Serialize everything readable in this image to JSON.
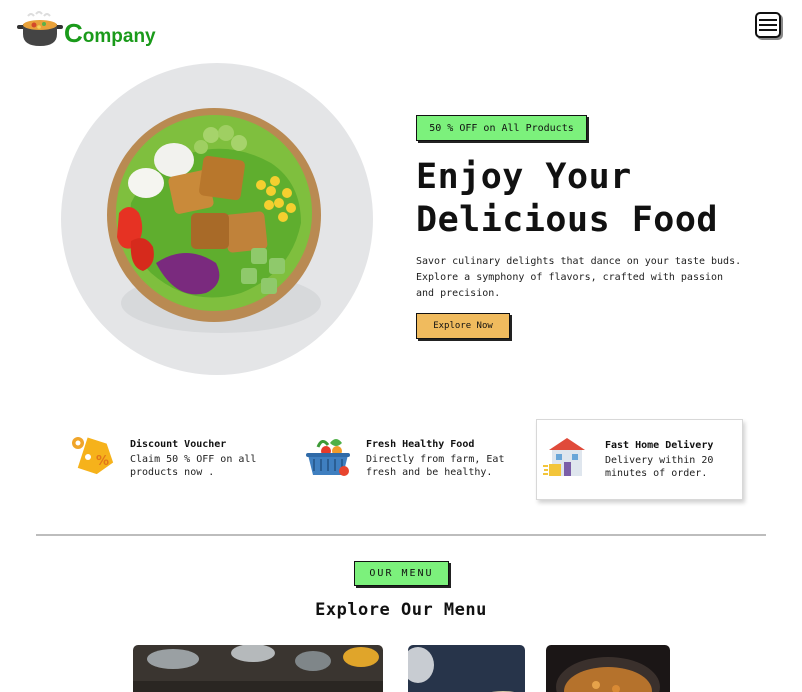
{
  "brand": {
    "logo_initial": "C",
    "logo_rest": "ompany"
  },
  "hero": {
    "offer_badge": "50 % OFF on All Products",
    "title_line1": "Enjoy Your",
    "title_line2": "Delicious Food",
    "description": "Savor culinary delights that dance on your taste buds. Explore a symphony of flavors, crafted with passion and precision.",
    "cta_label": "Explore Now"
  },
  "features": [
    {
      "title": "Discount Voucher",
      "desc_line1": "Claim 50 % OFF on all",
      "desc_line2": "products now .",
      "icon": "discount-tag-icon"
    },
    {
      "title": "Fresh Healthy Food",
      "desc_line1": "Directly from farm, Eat",
      "desc_line2": "fresh and be healthy.",
      "icon": "vegetable-basket-icon"
    },
    {
      "title": "Fast Home Delivery",
      "desc_line1": "Delivery within 20",
      "desc_line2": "minutes of order.",
      "icon": "home-delivery-icon"
    }
  ],
  "menu_section": {
    "badge": "OUR MENU",
    "title": "Explore Our Menu"
  },
  "colors": {
    "accent_green": "#7cf17c",
    "accent_orange": "#f0bb5e",
    "brand_green": "#1a9a1a"
  }
}
